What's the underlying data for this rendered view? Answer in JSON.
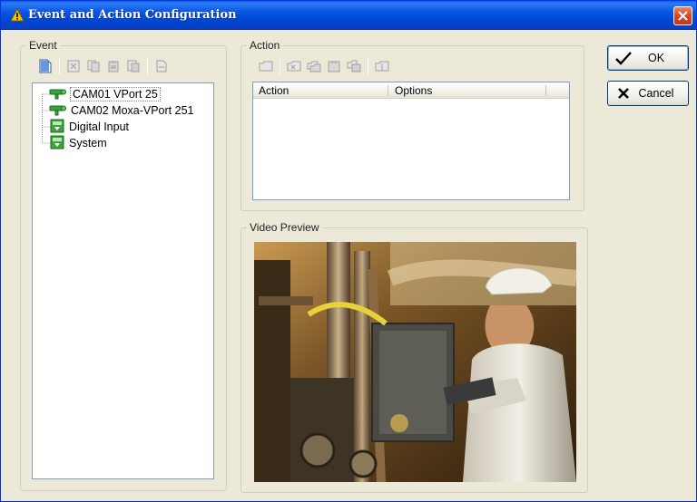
{
  "window": {
    "title": "Event and Action Configuration",
    "title_icon": "warning-icon",
    "close_icon": "close-icon",
    "colors": {
      "titlebar": "#0a55e0",
      "close": "#d6462a",
      "face": "#ece9d8"
    }
  },
  "event": {
    "legend": "Event",
    "toolbar": [
      "new-event-icon",
      "delete-icon",
      "copy-icon",
      "paste-icon",
      "properties-icon",
      "export-icon"
    ],
    "tree": [
      {
        "label": "CAM01 VPort 25",
        "icon": "camera-icon",
        "selected": true
      },
      {
        "label": "CAM02 Moxa-VPort 251",
        "icon": "camera-icon",
        "selected": false
      },
      {
        "label": "Digital Input",
        "icon": "digital-input-icon",
        "selected": false
      },
      {
        "label": "System",
        "icon": "system-icon",
        "selected": false
      }
    ]
  },
  "action": {
    "legend": "Action",
    "toolbar": [
      "new-action-icon",
      "delete-action-icon",
      "copy-action-icon",
      "paste-action-icon",
      "properties-action-icon",
      "test-action-icon"
    ],
    "columns": [
      "Action",
      "Options"
    ],
    "rows": []
  },
  "preview": {
    "legend": "Video Preview"
  },
  "buttons": {
    "ok": "OK",
    "cancel": "Cancel"
  }
}
